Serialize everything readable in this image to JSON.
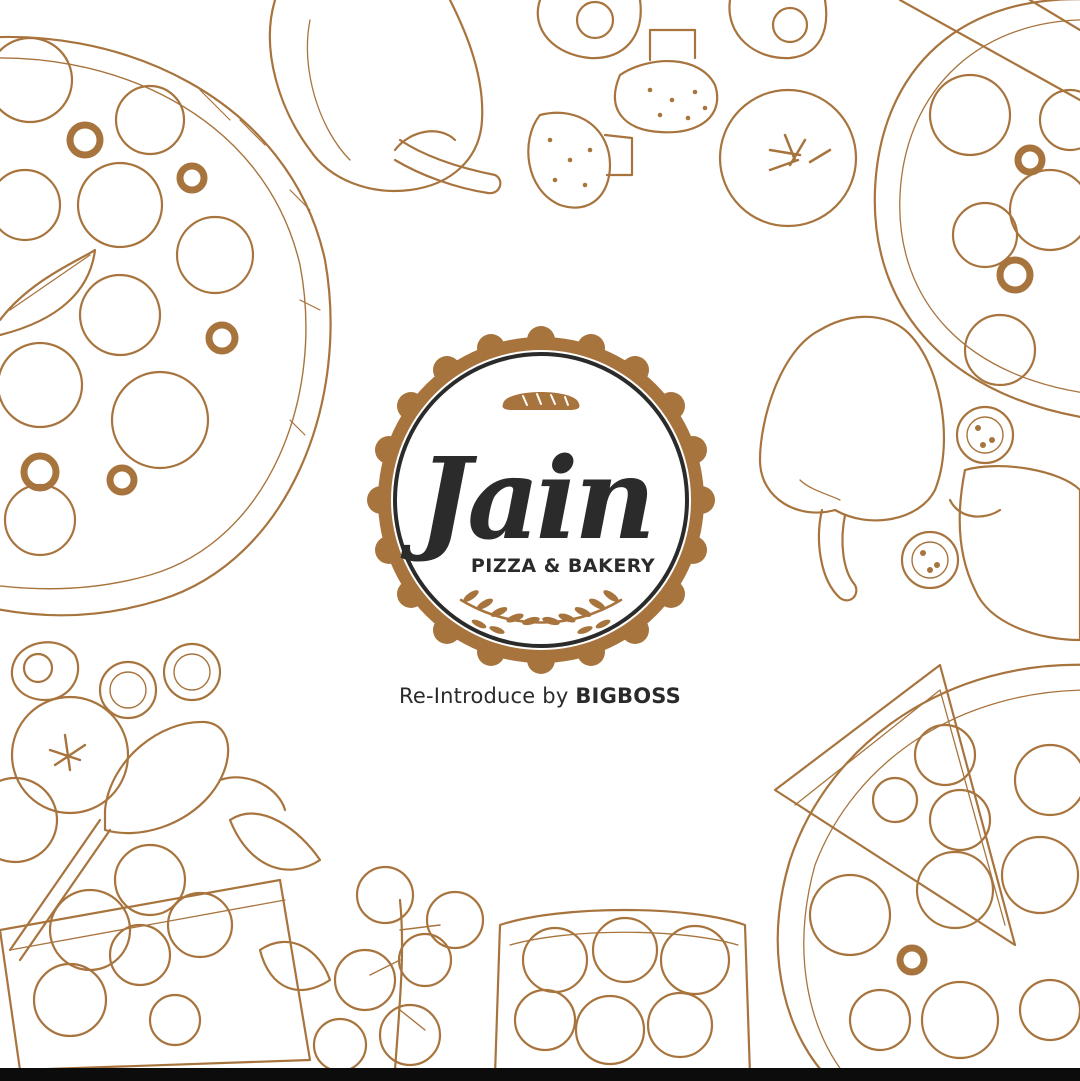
{
  "colors": {
    "ink": "#a8743e",
    "dark": "#2b2b2b",
    "text": "#2a2a2a",
    "bar": "#0c0c0c"
  },
  "logo": {
    "script_name": "Jain",
    "subtitle": "PIZZA & BAKERY"
  },
  "tagline": {
    "prefix": "Re-Introduce by ",
    "brand": "BIGBOSS"
  },
  "icons": [
    "pizza-icon",
    "bell-pepper-icon",
    "mushroom-icon",
    "tomato-icon",
    "tomato-slice-icon",
    "cutting-board-icon",
    "wooden-spoon-icon",
    "cherry-tomato-vine-icon",
    "mushroom-basket-icon",
    "pizza-slice-icon",
    "bread-loaf-icon",
    "wheat-laurel-icon"
  ]
}
